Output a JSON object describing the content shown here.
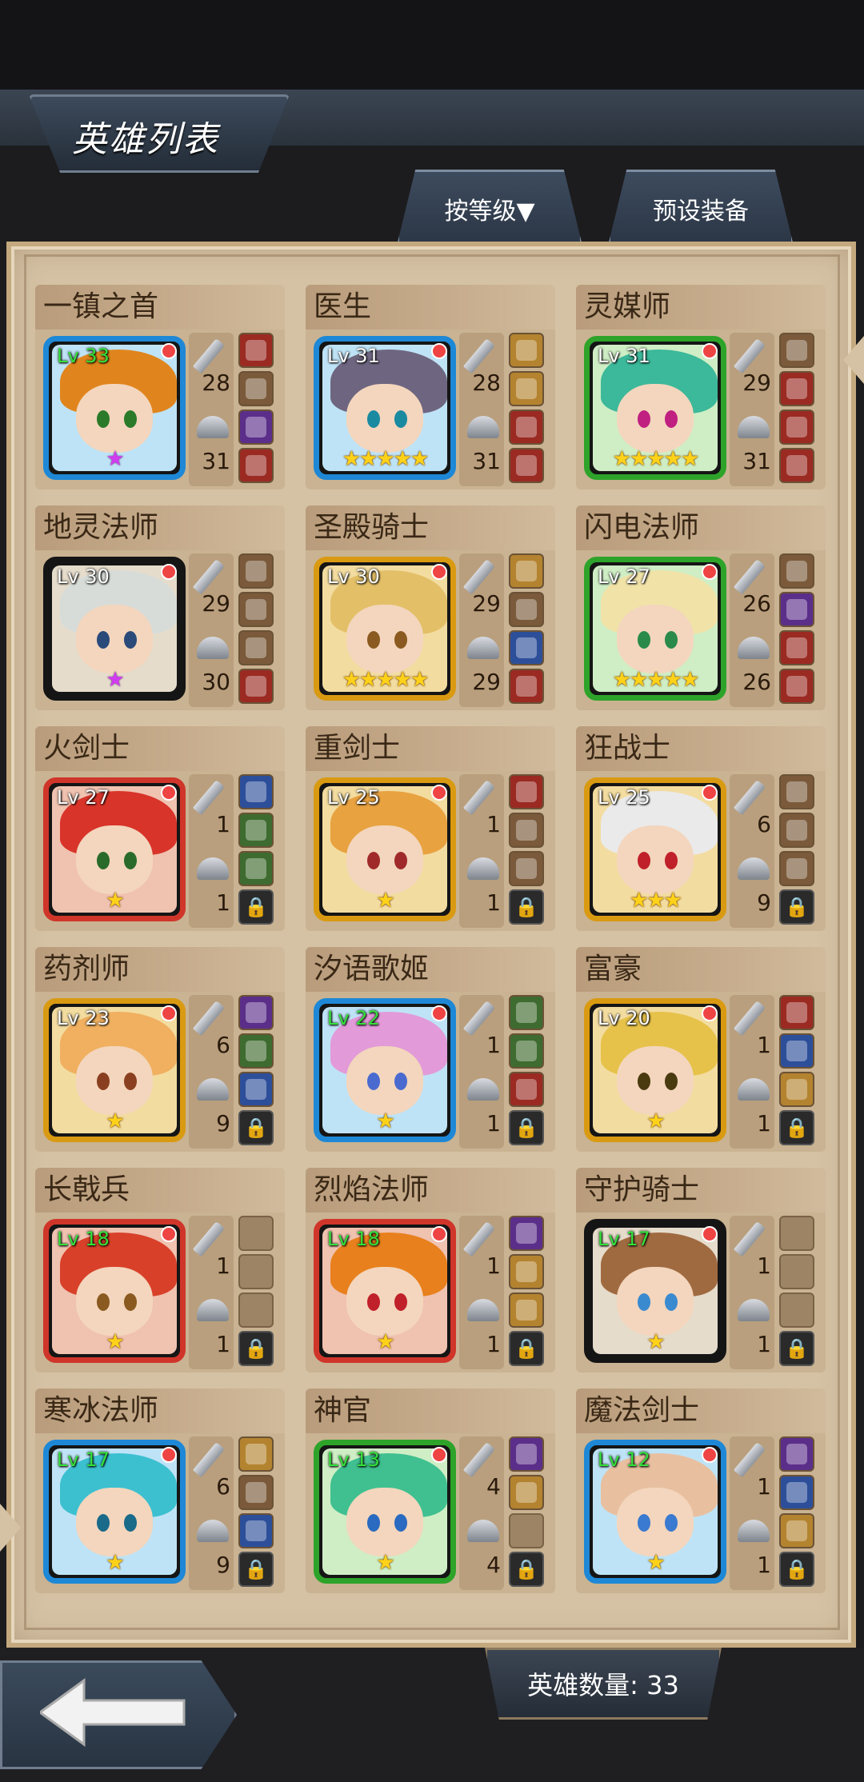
{
  "header": {
    "title": "英雄列表",
    "sort_button": "按等级▼",
    "preset_button": "预设装备"
  },
  "footer": {
    "hero_count_label": "英雄数量: 33"
  },
  "heroes": [
    {
      "name": "一镇之首",
      "level": "Lv 33",
      "lv_color": "green",
      "frame": "blue",
      "stars": "★",
      "star_color": "purple",
      "attack": "28",
      "defense": "31",
      "hair": "#e0851d",
      "eye": "#2a7a2a",
      "slots": [
        "red",
        "brown",
        "purple",
        "red"
      ]
    },
    {
      "name": "医生",
      "level": "Lv 31",
      "lv_color": "white",
      "frame": "blue",
      "stars": "★★★★★",
      "star_color": "gold",
      "attack": "28",
      "defense": "31",
      "hair": "#6e6680",
      "eye": "#1a8aa0",
      "slots": [
        "gold",
        "gold",
        "red",
        "red"
      ]
    },
    {
      "name": "灵媒师",
      "level": "Lv 31",
      "lv_color": "white",
      "frame": "green",
      "stars": "★★★★★",
      "star_color": "gold",
      "attack": "29",
      "defense": "31",
      "hair": "#3cb89a",
      "eye": "#c02080",
      "slots": [
        "brown",
        "red",
        "red",
        "red"
      ]
    },
    {
      "name": "地灵法师",
      "level": "Lv 30",
      "lv_color": "white",
      "frame": "black",
      "stars": "★",
      "star_color": "purple",
      "attack": "29",
      "defense": "30",
      "hair": "#d8dcd8",
      "eye": "#2a4a7a",
      "slots": [
        "brown",
        "brown",
        "brown",
        "red"
      ]
    },
    {
      "name": "圣殿骑士",
      "level": "Lv 30",
      "lv_color": "white",
      "frame": "gold",
      "stars": "★★★★★",
      "star_color": "gold",
      "attack": "29",
      "defense": "29",
      "hair": "#e3c068",
      "eye": "#8a5a20",
      "slots": [
        "gold",
        "brown",
        "blue",
        "red"
      ]
    },
    {
      "name": "闪电法师",
      "level": "Lv 27",
      "lv_color": "white",
      "frame": "green",
      "stars": "★★★★★",
      "star_color": "gold",
      "attack": "26",
      "defense": "26",
      "hair": "#f1e2a8",
      "eye": "#2a8a4a",
      "slots": [
        "brown",
        "purple",
        "red",
        "red"
      ]
    },
    {
      "name": "火剑士",
      "level": "Lv 27",
      "lv_color": "white",
      "frame": "red",
      "stars": "★",
      "star_color": "gold",
      "attack": "1",
      "defense": "1",
      "hair": "#d8342a",
      "eye": "#2a6a2a",
      "slots": [
        "blue",
        "green",
        "green",
        "locked"
      ]
    },
    {
      "name": "重剑士",
      "level": "Lv 25",
      "lv_color": "white",
      "frame": "gold",
      "stars": "★",
      "star_color": "gold",
      "attack": "1",
      "defense": "1",
      "hair": "#e8a240",
      "eye": "#a02a2a",
      "slots": [
        "red",
        "brown",
        "brown",
        "locked"
      ]
    },
    {
      "name": "狂战士",
      "level": "Lv 25",
      "lv_color": "white",
      "frame": "gold",
      "stars": "★★★",
      "star_color": "gold",
      "attack": "6",
      "defense": "9",
      "hair": "#eaeaea",
      "eye": "#c0202a",
      "slots": [
        "brown",
        "brown",
        "brown",
        "locked"
      ]
    },
    {
      "name": "药剂师",
      "level": "Lv 23",
      "lv_color": "white",
      "frame": "gold",
      "stars": "★",
      "star_color": "gold",
      "attack": "6",
      "defense": "9",
      "hair": "#f0b060",
      "eye": "#8a4020",
      "slots": [
        "purple",
        "green",
        "blue",
        "locked"
      ]
    },
    {
      "name": "汐语歌姬",
      "level": "Lv 22",
      "lv_color": "green",
      "frame": "blue",
      "stars": "★",
      "star_color": "gold",
      "attack": "1",
      "defense": "1",
      "hair": "#e29ad8",
      "eye": "#4a6ad0",
      "slots": [
        "green",
        "green",
        "red",
        "locked"
      ]
    },
    {
      "name": "富豪",
      "level": "Lv 20",
      "lv_color": "white",
      "frame": "gold",
      "stars": "★",
      "star_color": "gold",
      "attack": "1",
      "defense": "1",
      "hair": "#e6c24a",
      "eye": "#4a3a10",
      "slots": [
        "red",
        "blue",
        "gold",
        "locked"
      ]
    },
    {
      "name": "长戟兵",
      "level": "Lv 18",
      "lv_color": "green",
      "frame": "red",
      "stars": "★",
      "star_color": "gold",
      "attack": "1",
      "defense": "1",
      "hair": "#d8402a",
      "eye": "#8a5a20",
      "slots": [
        "empty",
        "empty",
        "empty",
        "locked"
      ]
    },
    {
      "name": "烈焰法师",
      "level": "Lv 18",
      "lv_color": "green",
      "frame": "red",
      "stars": "★",
      "star_color": "gold",
      "attack": "1",
      "defense": "1",
      "hair": "#e8801d",
      "eye": "#c0202a",
      "slots": [
        "purple",
        "gold",
        "gold",
        "locked"
      ]
    },
    {
      "name": "守护骑士",
      "level": "Lv 17",
      "lv_color": "green",
      "frame": "black",
      "stars": "★",
      "star_color": "gold",
      "attack": "1",
      "defense": "1",
      "hair": "#a06a40",
      "eye": "#3a8ad0",
      "slots": [
        "empty",
        "empty",
        "empty",
        "locked"
      ]
    },
    {
      "name": "寒冰法师",
      "level": "Lv 17",
      "lv_color": "green",
      "frame": "blue",
      "stars": "★",
      "star_color": "gold",
      "attack": "6",
      "defense": "9",
      "hair": "#3cc0d0",
      "eye": "#1a6a8a",
      "slots": [
        "gold",
        "brown",
        "blue",
        "locked"
      ]
    },
    {
      "name": "神官",
      "level": "Lv 13",
      "lv_color": "green",
      "frame": "green",
      "stars": "★",
      "star_color": "gold",
      "attack": "4",
      "defense": "4",
      "hair": "#40c090",
      "eye": "#2a6ac0",
      "slots": [
        "purple",
        "gold",
        "empty",
        "locked"
      ]
    },
    {
      "name": "魔法剑士",
      "level": "Lv 12",
      "lv_color": "green",
      "frame": "blue",
      "stars": "★",
      "star_color": "gold",
      "attack": "1",
      "defense": "1",
      "hair": "#e8c0a0",
      "eye": "#3a7ad0",
      "slots": [
        "purple",
        "blue",
        "gold",
        "locked"
      ]
    }
  ]
}
